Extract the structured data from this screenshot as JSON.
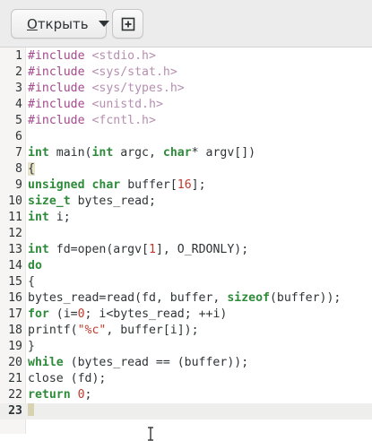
{
  "toolbar": {
    "open_label_prefix": "О",
    "open_label_rest": "ткрыть",
    "open_dropdown_icon": "chevron-down-icon",
    "new_document_icon": "new-document-icon"
  },
  "editor": {
    "current_line": 23,
    "lines": [
      {
        "n": "1",
        "code": "#include <stdio.h>"
      },
      {
        "n": "2",
        "code": "#include <sys/stat.h>"
      },
      {
        "n": "3",
        "code": "#include <sys/types.h>"
      },
      {
        "n": "4",
        "code": "#include <unistd.h>"
      },
      {
        "n": "5",
        "code": "#include <fcntl.h>"
      },
      {
        "n": "6",
        "code": ""
      },
      {
        "n": "7",
        "code": "int main(int argc, char* argv[])"
      },
      {
        "n": "8",
        "code": "{"
      },
      {
        "n": "9",
        "code": "unsigned char buffer[16];"
      },
      {
        "n": "10",
        "code": "size_t bytes_read;"
      },
      {
        "n": "11",
        "code": "int i;"
      },
      {
        "n": "12",
        "code": ""
      },
      {
        "n": "13",
        "code": "int fd=open(argv[1], O_RDONLY);"
      },
      {
        "n": "14",
        "code": "do"
      },
      {
        "n": "15",
        "code": "{"
      },
      {
        "n": "16",
        "code": "bytes_read=read(fd, buffer, sizeof(buffer));"
      },
      {
        "n": "17",
        "code": "for (i=0; i<bytes_read; ++i)"
      },
      {
        "n": "18",
        "code": "printf(\"%c\", buffer[i]);"
      },
      {
        "n": "19",
        "code": "}"
      },
      {
        "n": "20",
        "code": "while (bytes_read == (buffer));"
      },
      {
        "n": "21",
        "code": "close (fd);"
      },
      {
        "n": "22",
        "code": "return 0;"
      },
      {
        "n": "23",
        "code": ""
      }
    ]
  }
}
